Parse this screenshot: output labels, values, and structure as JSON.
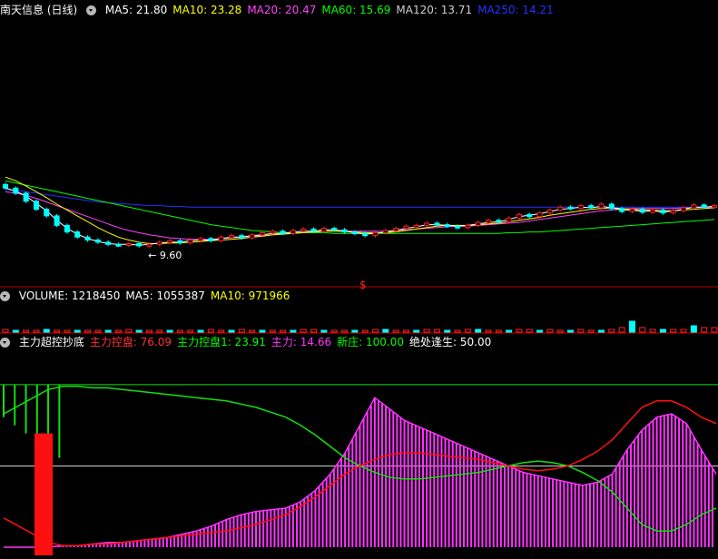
{
  "main_panel": {
    "title": "南天信息 (日线)",
    "ma_labels": [
      {
        "text": "MA5: 21.80",
        "color": "#ffffff"
      },
      {
        "text": "MA10: 23.28",
        "color": "#ffff00"
      },
      {
        "text": "MA20: 20.47",
        "color": "#ff44ff"
      },
      {
        "text": "MA60: 15.69",
        "color": "#00ff00"
      },
      {
        "text": "MA120: 13.71",
        "color": "#cfcfcf"
      },
      {
        "text": "MA250: 14.21",
        "color": "#2233ff"
      }
    ],
    "low_label": "9.60",
    "marker": "$"
  },
  "volume_panel": {
    "labels": [
      {
        "text": "VOLUME: 1218450",
        "color": "#ffffff"
      },
      {
        "text": "MA5: 1055387",
        "color": "#ffffff"
      },
      {
        "text": "MA10: 971966",
        "color": "#ffff00"
      }
    ]
  },
  "indicator_panel": {
    "labels": [
      {
        "text": "主力超控抄底",
        "color": "#ffffff"
      },
      {
        "text": "主力控盘: 76.09",
        "color": "#ff3333"
      },
      {
        "text": "主力控盘1: 23.91",
        "color": "#00ff00"
      },
      {
        "text": "主力: 14.66",
        "color": "#ff33ff"
      },
      {
        "text": "新庄: 100.00",
        "color": "#00ff00"
      },
      {
        "text": "绝处逢生: 50.00",
        "color": "#ffffff"
      }
    ]
  },
  "colors": {
    "border": "#c00000",
    "up": "#ff2222",
    "down": "#00ffff",
    "ma5": "#ffffff",
    "ma10": "#ffff00",
    "ma20": "#ff44ff",
    "ma60": "#00ff00",
    "ma250": "#2233ff",
    "control": "#ff1010",
    "control1": "#10e010",
    "main_force": "#ff33ff",
    "mid_line": "#cfcfcf"
  },
  "chart_data": {
    "type": "line",
    "price": {
      "close": [
        22.0,
        21.3,
        20.2,
        19.1,
        18.2,
        16.9,
        16.0,
        15.3,
        14.9,
        14.6,
        14.3,
        14.2,
        14.4,
        14.1,
        14.3,
        14.6,
        14.8,
        14.5,
        14.9,
        15.1,
        14.8,
        15.3,
        15.5,
        15.2,
        15.6,
        15.9,
        16.1,
        15.8,
        16.2,
        16.4,
        16.1,
        16.5,
        16.3,
        16.0,
        15.8,
        15.5,
        15.9,
        16.2,
        16.5,
        16.8,
        16.9,
        17.2,
        17.0,
        16.8,
        16.6,
        16.9,
        17.3,
        17.6,
        17.4,
        17.9,
        18.4,
        18.1,
        18.6,
        19.0,
        19.4,
        19.2,
        19.6,
        19.3,
        19.8,
        19.2,
        18.8,
        19.1,
        18.7,
        19.0,
        18.6,
        18.9,
        19.3,
        19.7,
        19.4,
        19.6
      ],
      "ma5": [
        22.0,
        21.6,
        20.9,
        19.9,
        18.9,
        17.6,
        16.5,
        15.7,
        15.1,
        14.7,
        14.4,
        14.3,
        14.3,
        14.2,
        14.3,
        14.5,
        14.6,
        14.6,
        14.8,
        14.9,
        14.9,
        15.1,
        15.3,
        15.3,
        15.5,
        15.6,
        15.8,
        15.8,
        16.0,
        16.1,
        16.1,
        16.3,
        16.3,
        16.1,
        15.9,
        15.7,
        15.8,
        16.0,
        16.2,
        16.5,
        16.7,
        17.0,
        17.0,
        16.9,
        16.8,
        16.9,
        17.1,
        17.3,
        17.4,
        17.7,
        18.1,
        18.3,
        18.5,
        18.8,
        19.1,
        19.2,
        19.4,
        19.3,
        19.5,
        19.3,
        19.0,
        19.0,
        18.8,
        18.9,
        18.7,
        18.9,
        19.1,
        19.4,
        19.4,
        19.5
      ],
      "ma10": [
        23.5,
        23.0,
        22.3,
        21.5,
        20.7,
        19.8,
        19.0,
        18.2,
        17.4,
        16.6,
        15.9,
        15.3,
        14.9,
        14.6,
        14.4,
        14.4,
        14.5,
        14.5,
        14.6,
        14.7,
        14.8,
        14.9,
        15.0,
        15.1,
        15.3,
        15.4,
        15.6,
        15.7,
        15.8,
        15.9,
        16.0,
        16.1,
        16.1,
        16.1,
        16.0,
        15.9,
        15.9,
        15.9,
        16.0,
        16.2,
        16.4,
        16.6,
        16.8,
        16.9,
        16.9,
        16.9,
        17.0,
        17.1,
        17.2,
        17.4,
        17.6,
        17.8,
        18.0,
        18.3,
        18.5,
        18.7,
        18.9,
        19.1,
        19.2,
        19.3,
        19.2,
        19.1,
        19.0,
        19.0,
        18.9,
        18.9,
        19.0,
        19.1,
        19.2,
        19.3
      ],
      "ma20": [
        21.5,
        21.3,
        21.0,
        20.6,
        20.1,
        19.6,
        19.1,
        18.6,
        18.1,
        17.6,
        17.1,
        16.6,
        16.2,
        15.9,
        15.6,
        15.4,
        15.2,
        15.1,
        15.0,
        15.0,
        15.0,
        15.1,
        15.2,
        15.3,
        15.4,
        15.5,
        15.6,
        15.7,
        15.8,
        15.9,
        16.0,
        16.1,
        16.1,
        16.1,
        16.1,
        16.1,
        16.1,
        16.1,
        16.2,
        16.3,
        16.4,
        16.5,
        16.6,
        16.7,
        16.8,
        16.8,
        16.9,
        17.0,
        17.1,
        17.2,
        17.3,
        17.5,
        17.7,
        17.9,
        18.1,
        18.3,
        18.5,
        18.7,
        18.9,
        19.0,
        19.1,
        19.2,
        19.2,
        19.2,
        19.2,
        19.2,
        19.3,
        19.3,
        19.4,
        19.4
      ],
      "ma60": [
        23.0,
        22.7,
        22.4,
        22.1,
        21.8,
        21.5,
        21.2,
        20.9,
        20.6,
        20.3,
        20.0,
        19.7,
        19.4,
        19.1,
        18.8,
        18.5,
        18.2,
        17.9,
        17.6,
        17.3,
        17.0,
        16.8,
        16.6,
        16.4,
        16.2,
        16.1,
        16.0,
        15.9,
        15.9,
        15.9,
        15.9,
        15.9,
        15.8,
        15.8,
        15.8,
        15.8,
        15.8,
        15.8,
        15.8,
        15.8,
        15.8,
        15.8,
        15.8,
        15.8,
        15.8,
        15.8,
        15.8,
        15.8,
        15.8,
        15.9,
        15.9,
        16.0,
        16.0,
        16.1,
        16.2,
        16.3,
        16.4,
        16.5,
        16.6,
        16.7,
        16.8,
        16.9,
        17.0,
        17.1,
        17.2,
        17.3,
        17.4,
        17.5,
        17.6,
        17.7
      ],
      "ma250": [
        21.8,
        21.7,
        21.5,
        21.3,
        21.1,
        20.9,
        20.7,
        20.5,
        20.3,
        20.1,
        20.0,
        19.9,
        19.8,
        19.7,
        19.6,
        19.6,
        19.5,
        19.5,
        19.4,
        19.4,
        19.4,
        19.4,
        19.4,
        19.4,
        19.4,
        19.4,
        19.4,
        19.4,
        19.4,
        19.4,
        19.4,
        19.4,
        19.4,
        19.4,
        19.4,
        19.4,
        19.4,
        19.4,
        19.4,
        19.4,
        19.4,
        19.4,
        19.4,
        19.4,
        19.4,
        19.4,
        19.4,
        19.4,
        19.4,
        19.4,
        19.4,
        19.4,
        19.4,
        19.4,
        19.4,
        19.4,
        19.4,
        19.4,
        19.4,
        19.4,
        19.4,
        19.4,
        19.4,
        19.4,
        19.4,
        19.4,
        19.4,
        19.4,
        19.4,
        19.4
      ],
      "ylim": [
        9.0,
        45.0
      ]
    },
    "volume": {
      "values": [
        3,
        2,
        2,
        2,
        3,
        2,
        2,
        2,
        2,
        2,
        2,
        2,
        3,
        2,
        2,
        2,
        2,
        2,
        2,
        2,
        3,
        2,
        2,
        3,
        2,
        2,
        2,
        2,
        2,
        3,
        3,
        2,
        2,
        2,
        2,
        2,
        3,
        3,
        2,
        2,
        2,
        3,
        3,
        2,
        2,
        3,
        3,
        2,
        2,
        2,
        3,
        3,
        2,
        3,
        2,
        2,
        3,
        2,
        2,
        3,
        5,
        12,
        5,
        3,
        3,
        3,
        3,
        7,
        5,
        5
      ],
      "ylim": [
        0,
        30
      ]
    },
    "indicator": {
      "control": [
        18,
        13,
        8,
        3,
        1,
        1,
        2,
        2,
        3,
        4,
        5,
        6,
        7,
        8,
        9,
        10,
        12,
        14,
        17,
        20,
        25,
        31,
        38,
        45,
        50,
        54,
        57,
        58,
        58,
        57,
        56,
        55,
        54,
        52,
        50,
        48,
        47,
        48,
        50,
        54,
        59,
        66,
        76,
        86,
        90,
        90,
        86,
        80,
        76
      ],
      "control1": [
        82,
        87,
        92,
        97,
        99,
        99,
        98,
        98,
        97,
        96,
        95,
        94,
        93,
        92,
        91,
        90,
        88,
        86,
        83,
        80,
        75,
        69,
        62,
        55,
        50,
        46,
        43,
        42,
        42,
        43,
        44,
        45,
        46,
        48,
        50,
        52,
        53,
        52,
        50,
        46,
        41,
        34,
        24,
        14,
        10,
        10,
        14,
        20,
        24
      ],
      "main_force": [
        0,
        0,
        0,
        0,
        1,
        1,
        2,
        3,
        3,
        4,
        5,
        6,
        8,
        10,
        13,
        17,
        20,
        22,
        23,
        24,
        28,
        35,
        45,
        58,
        75,
        92,
        85,
        78,
        74,
        70,
        66,
        62,
        58,
        54,
        50,
        46,
        44,
        42,
        40,
        38,
        40,
        45,
        60,
        72,
        80,
        82,
        76,
        60,
        45
      ],
      "ylim": [
        -5,
        120
      ],
      "mid_value": 50
    }
  }
}
